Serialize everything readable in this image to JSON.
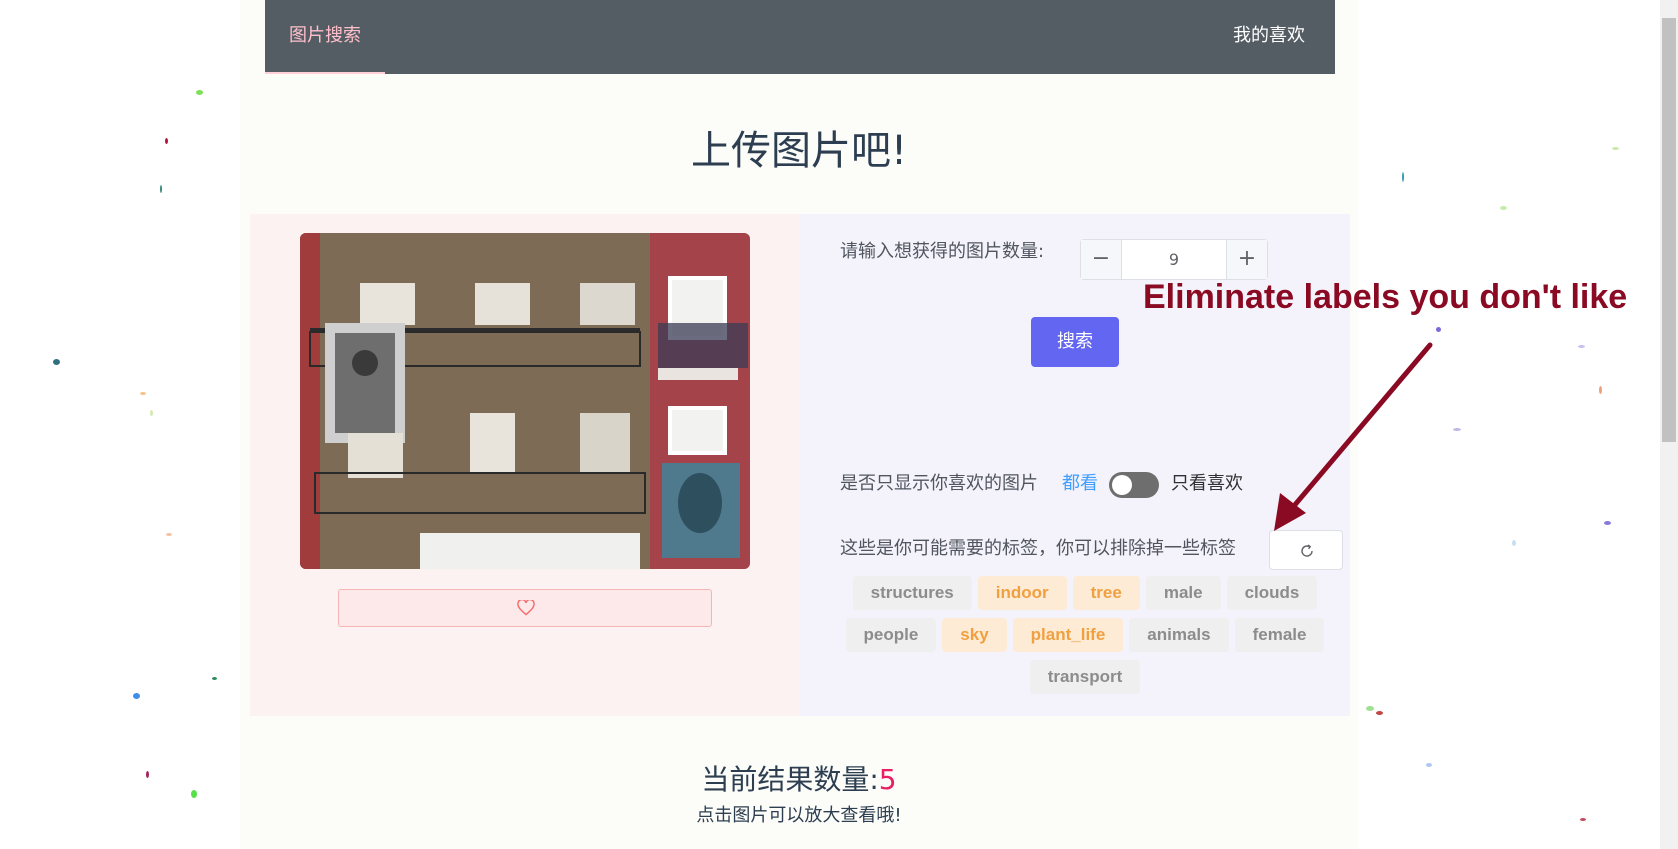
{
  "nav": {
    "search_label": "图片搜索",
    "favorites_label": "我的喜欢"
  },
  "page_title": "上传图片吧!",
  "photo": {
    "alt": "",
    "liked": false,
    "like_icon": "heart-outline-icon"
  },
  "controls": {
    "count_label": "请输入想获得的图片数量:",
    "count_value": "9",
    "minus_symbol": "−",
    "plus_symbol": "+",
    "search_label": "搜索",
    "favorites_only_label": "是否只显示你喜欢的图片",
    "toggle_off_label": "都看",
    "toggle_on_label": "只看喜欢",
    "toggle_state": false,
    "tags_label": "这些是你可能需要的标签，你可以排除掉一些标签",
    "reset_icon": "refresh-icon"
  },
  "tags": [
    {
      "label": "structures",
      "active": false
    },
    {
      "label": "indoor",
      "active": true
    },
    {
      "label": "tree",
      "active": true
    },
    {
      "label": "male",
      "active": false
    },
    {
      "label": "clouds",
      "active": false
    },
    {
      "label": "people",
      "active": false
    },
    {
      "label": "sky",
      "active": true
    },
    {
      "label": "plant_life",
      "active": true
    },
    {
      "label": "animals",
      "active": false
    },
    {
      "label": "female",
      "active": false
    },
    {
      "label": "transport",
      "active": false
    }
  ],
  "results": {
    "label": "当前结果数量:",
    "count": "5",
    "hint": "点击图片可以放大查看哦!"
  },
  "annotation": {
    "text": "Eliminate labels you don't like"
  },
  "colors": {
    "nav_bg": "#545c64",
    "accent_pink": "#ffc0cb",
    "primary": "#6366f1",
    "tag_active_text": "#f0a040",
    "tag_active_bg": "#fdebd5",
    "annotation": "#8b0a23",
    "result_count": "#e91e63"
  }
}
